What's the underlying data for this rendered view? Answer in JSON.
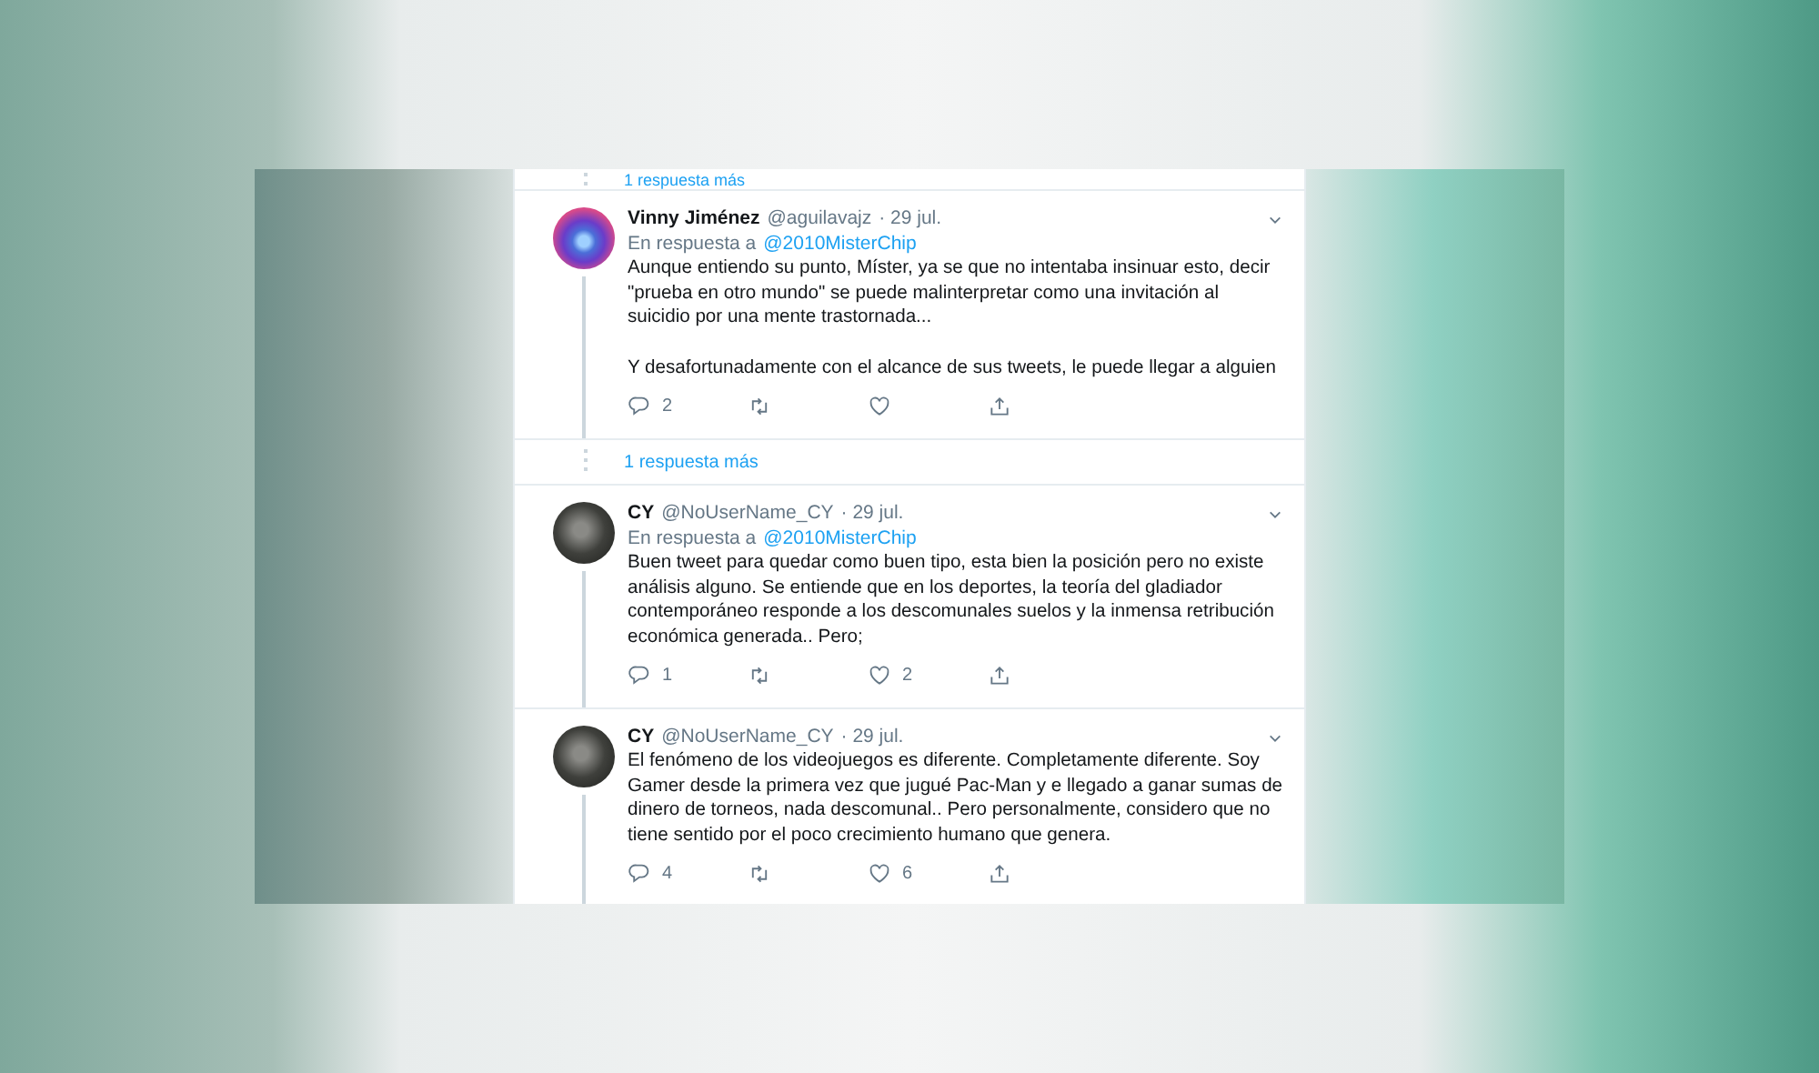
{
  "thread": [
    {
      "kind": "more",
      "label": "1 respuesta más"
    },
    {
      "kind": "tweet",
      "avatar": {
        "kind": "logo"
      },
      "name": "Vinny Jiménez",
      "handle": "@aguilavajz",
      "date": "· 29 jul.",
      "reply_prefix": "En respuesta a",
      "reply_to": "@2010MisterChip",
      "paragraphs": [
        "Aunque entiendo su punto, Míster, ya se que no intentaba insinuar esto, decir \"prueba en otro mundo\" se puede malinterpretar como una invitación al suicidio por una mente trastornada...",
        "Y desafortunadamente con el alcance de sus tweets, le puede llegar a alguien"
      ],
      "replies": "2"
    },
    {
      "kind": "more",
      "label": "1 respuesta más"
    },
    {
      "kind": "tweet",
      "avatar": {
        "kind": "photo"
      },
      "name": "CY",
      "handle": "@NoUserName_CY",
      "date": "· 29 jul.",
      "reply_prefix": "En respuesta a",
      "reply_to": "@2010MisterChip",
      "paragraphs": [
        "Buen tweet para quedar como buen tipo, esta bien la posición pero no existe análisis alguno. Se entiende que en los deportes, la teoría del gladiador contemporáneo responde a los descomunales suelos y la inmensa retribución económica generada.. Pero;"
      ],
      "replies": "1",
      "likes": "2"
    },
    {
      "kind": "tweet",
      "avatar": {
        "kind": "photo"
      },
      "name": "CY",
      "handle": "@NoUserName_CY",
      "date": "· 29 jul.",
      "paragraphs": [
        "El fenómeno de los videojuegos es diferente. Completamente diferente. Soy Gamer desde la primera vez que jugué Pac-Man y e llegado a ganar sumas de dinero de torneos, nada descomunal.. Pero personalmente, considero que no tiene sentido por el poco crecimiento humano que genera."
      ],
      "replies": "4",
      "likes": "6"
    }
  ]
}
